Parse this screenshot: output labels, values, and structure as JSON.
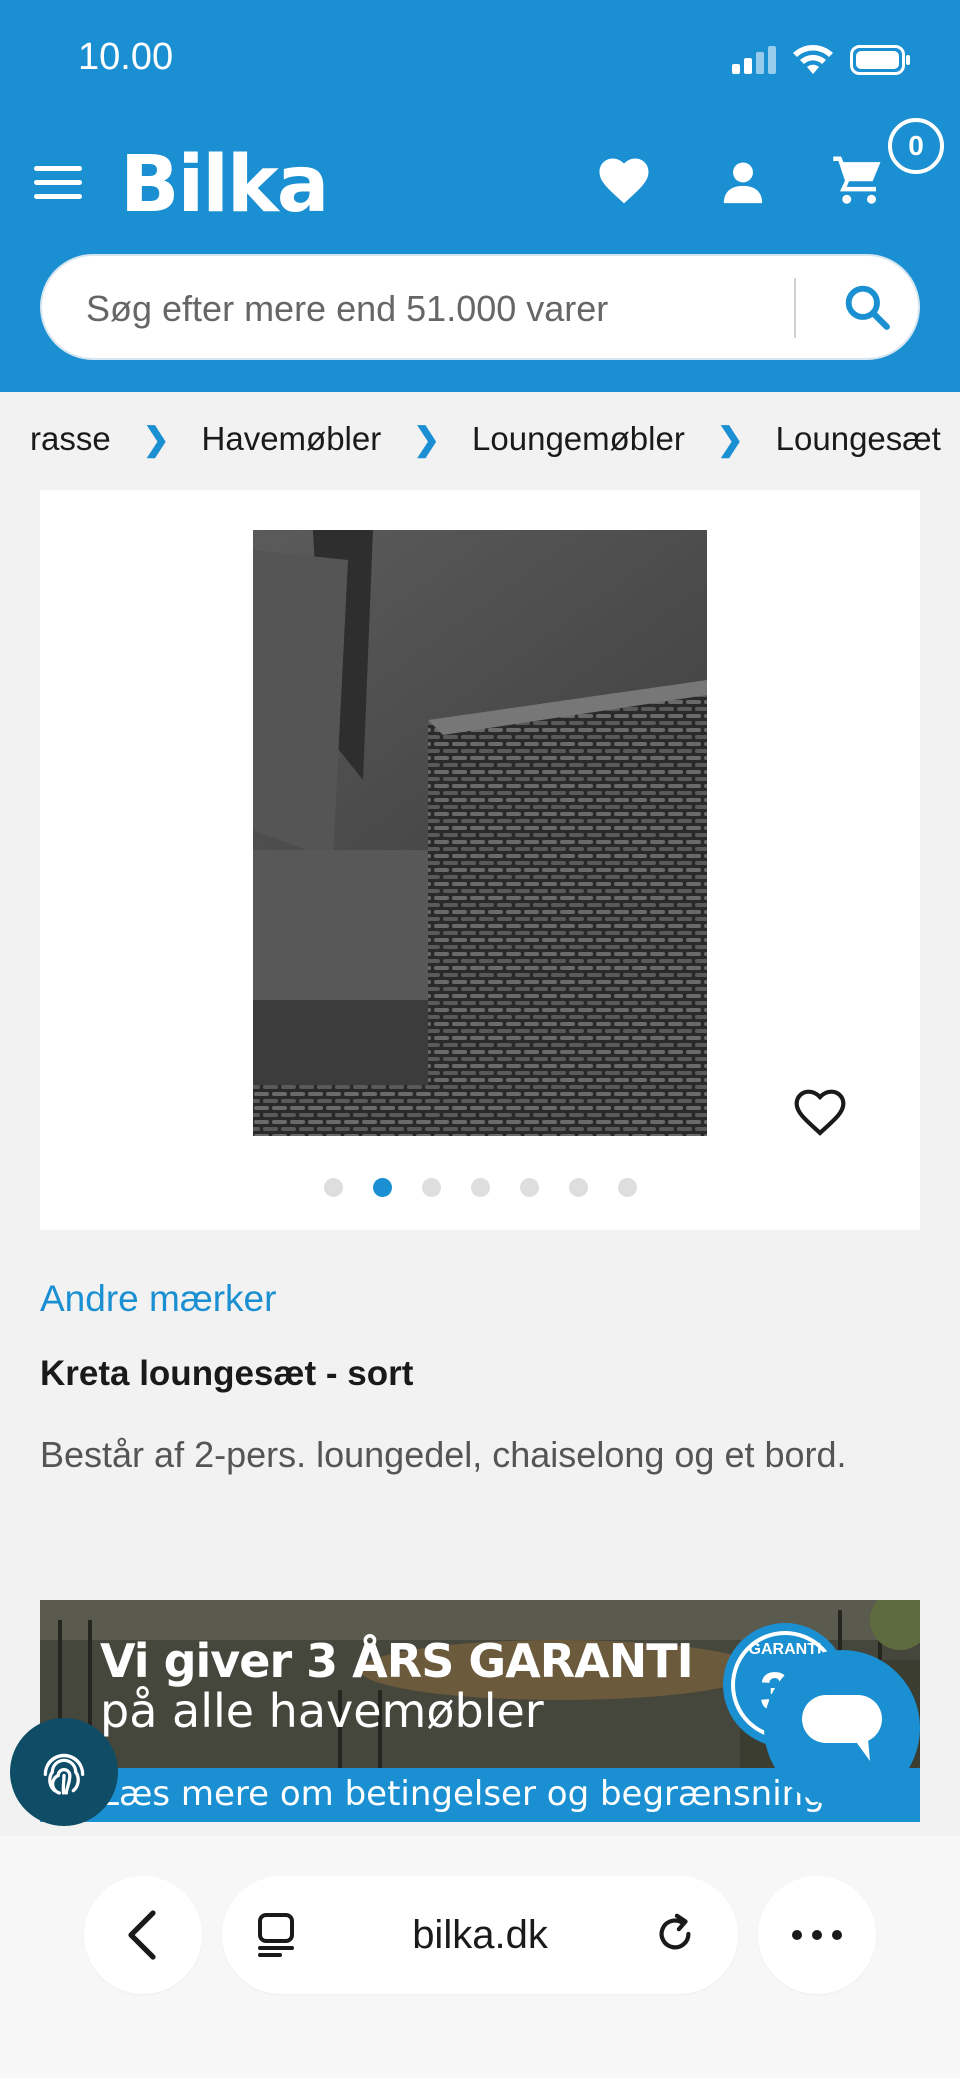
{
  "status": {
    "time": "10.00"
  },
  "header": {
    "logo": "Bilka",
    "cart_count": "0",
    "brand_color": "#1a8fd1"
  },
  "search": {
    "placeholder": "Søg efter mere end 51.000 varer"
  },
  "breadcrumb": {
    "items": [
      "rasse",
      "Havemøbler",
      "Loungemøbler",
      "Loungesæt"
    ]
  },
  "gallery": {
    "total": 7,
    "active_index": 1
  },
  "product": {
    "brand": "Andre mærker",
    "title": "Kreta loungesæt - sort",
    "description": "Består af 2-pers. loungedel, chaiselong og et bord."
  },
  "banner": {
    "title": "Vi giver 3 ÅRS GARANTI",
    "subtitle": "på alle havemøbler",
    "link": "Læs mere om betingelser og begrænsninger",
    "seal_top": "GARANTI",
    "seal_mid": "3"
  },
  "browser": {
    "url": "bilka.dk"
  }
}
